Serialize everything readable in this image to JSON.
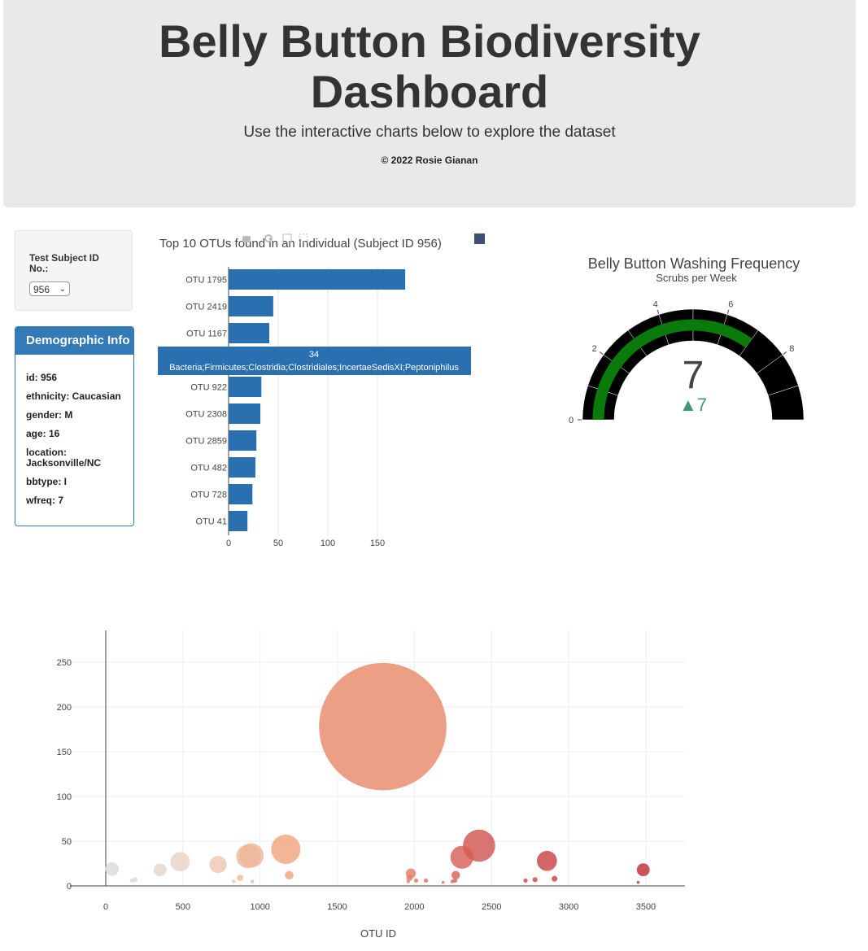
{
  "header": {
    "title_line1": "Belly Button Biodiversity",
    "title_line2": "Dashboard",
    "lead": "Use the interactive charts below to explore the dataset",
    "copyright": "© 2022 Rosie Gianan"
  },
  "selector": {
    "label": "Test Subject ID No.:",
    "selected": "956"
  },
  "demographics": {
    "heading": "Demographic Info",
    "rows": [
      "id: 956",
      "ethnicity: Caucasian",
      "gender: M",
      "age: 16",
      "location: Jacksonville/NC",
      "bbtype: I",
      "wfreq: 7"
    ]
  },
  "colors": {
    "bar": "#2a6fb0",
    "panel": "#337ab7",
    "gauge_bar": "#0a7a0a",
    "delta": "#3d9970"
  },
  "tooltip": {
    "value": "34",
    "label": "Bacteria;Firmicutes;Clostridia;Clostridiales;IncertaeSedisXI;Peptoniphilus"
  },
  "chart_data": [
    {
      "type": "bar",
      "orientation": "horizontal",
      "title": "Top 10 OTUs found in an Individual (Subject ID 956)",
      "categories": [
        "OTU 1795",
        "OTU 2419",
        "OTU 1167",
        "OTU 944",
        "OTU 922",
        "OTU 2308",
        "OTU 2859",
        "OTU 482",
        "OTU 728",
        "OTU 41"
      ],
      "values": [
        178,
        45,
        41,
        34,
        33,
        32,
        28,
        27,
        24,
        19
      ],
      "xlim": [
        0,
        180
      ],
      "xticks": [
        0,
        50,
        100,
        150
      ]
    },
    {
      "type": "gauge",
      "title": "Belly Button Washing Frequency",
      "subtitle": "Scrubs per Week",
      "value": 7,
      "delta": "▲7",
      "range": [
        0,
        10
      ],
      "ticks": [
        0,
        2,
        4,
        6,
        8
      ]
    },
    {
      "type": "scatter",
      "subtype": "bubble",
      "xlabel": "OTU ID",
      "xlim": [
        -100,
        3750
      ],
      "ylim": [
        -5,
        280
      ],
      "xticks": [
        0,
        500,
        1000,
        1500,
        2000,
        2500,
        3000,
        3500
      ],
      "yticks": [
        0,
        50,
        100,
        150,
        200,
        250
      ],
      "points": [
        {
          "x": 41,
          "y": 19
        },
        {
          "x": 170,
          "y": 6
        },
        {
          "x": 190,
          "y": 7
        },
        {
          "x": 352,
          "y": 18
        },
        {
          "x": 482,
          "y": 27
        },
        {
          "x": 728,
          "y": 24
        },
        {
          "x": 830,
          "y": 5
        },
        {
          "x": 870,
          "y": 9
        },
        {
          "x": 922,
          "y": 33
        },
        {
          "x": 944,
          "y": 34
        },
        {
          "x": 950,
          "y": 5
        },
        {
          "x": 1167,
          "y": 41
        },
        {
          "x": 1189,
          "y": 12
        },
        {
          "x": 1795,
          "y": 178
        },
        {
          "x": 1960,
          "y": 5
        },
        {
          "x": 1968,
          "y": 9
        },
        {
          "x": 1977,
          "y": 14
        },
        {
          "x": 2011,
          "y": 6
        },
        {
          "x": 2075,
          "y": 6
        },
        {
          "x": 2186,
          "y": 4
        },
        {
          "x": 2246,
          "y": 5
        },
        {
          "x": 2264,
          "y": 6
        },
        {
          "x": 2268,
          "y": 12
        },
        {
          "x": 2308,
          "y": 32
        },
        {
          "x": 2419,
          "y": 45
        },
        {
          "x": 2720,
          "y": 6
        },
        {
          "x": 2782,
          "y": 7
        },
        {
          "x": 2859,
          "y": 28
        },
        {
          "x": 2908,
          "y": 8
        },
        {
          "x": 3450,
          "y": 4
        },
        {
          "x": 3483,
          "y": 18
        }
      ]
    }
  ]
}
